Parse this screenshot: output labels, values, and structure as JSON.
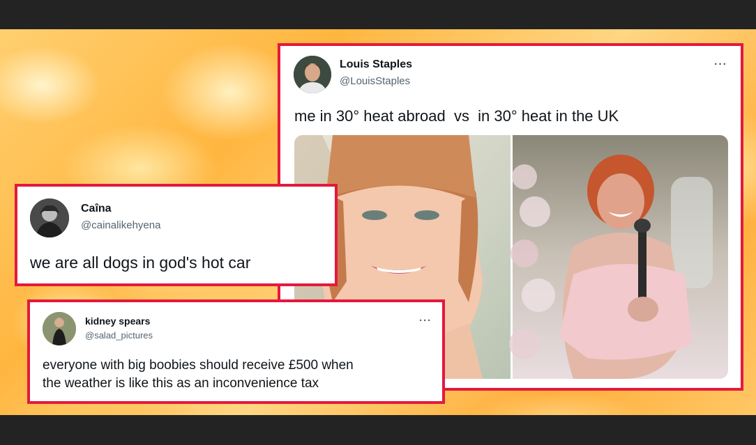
{
  "tweets": {
    "louis": {
      "name": "Louis Staples",
      "handle": "@LouisStaples",
      "text": "me in 30° heat abroad  vs  in 30° heat in the UK",
      "more": "···"
    },
    "caina": {
      "name": "Caîna",
      "handle": "@cainalikehyena",
      "text": "we are all dogs in god's hot car"
    },
    "kidney": {
      "name": "kidney spears",
      "handle": "@salad_pictures",
      "text_line1": "everyone with big boobies should receive £500 when",
      "text_line2": "the weather is like this as an inconvenience tax",
      "more": "···"
    }
  },
  "colors": {
    "border": "#e3193d",
    "letterbox": "#232323"
  }
}
